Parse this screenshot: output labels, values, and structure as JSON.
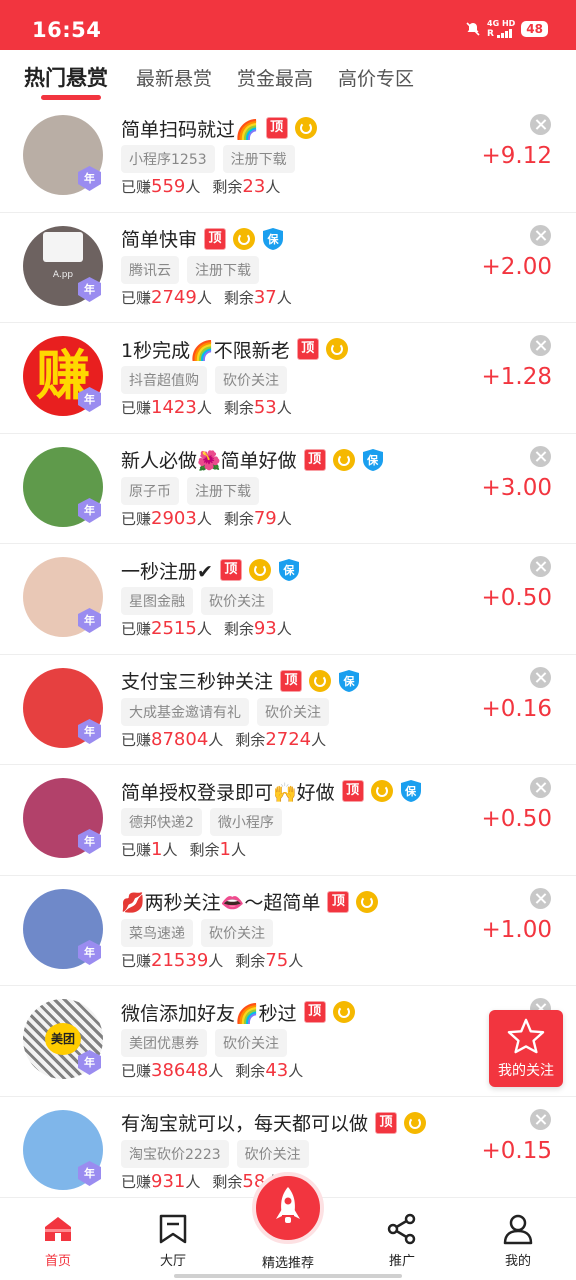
{
  "status_bar": {
    "time": "16:54",
    "network": "4G HD",
    "signal_label": "R",
    "battery": "48"
  },
  "tabs": [
    {
      "label": "热门悬赏",
      "active": true
    },
    {
      "label": "最新悬赏",
      "active": false
    },
    {
      "label": "赏金最高",
      "active": false
    },
    {
      "label": "高价专区",
      "active": false
    }
  ],
  "year_badge": "年",
  "top_badge": "顶",
  "guarantee_badge": "保",
  "earned_prefix": "已赚",
  "remaining_prefix": "剩余",
  "person_unit": "人",
  "tasks": [
    {
      "title": "简单扫码就过🌈",
      "tags": [
        "小程序1253",
        "注册下载"
      ],
      "earned": "559",
      "remaining": "23",
      "reward": "+9.12",
      "top": true,
      "coin": true,
      "guarantee": false,
      "avatar_color": "#b9aea5"
    },
    {
      "title": "简单快审",
      "tags": [
        "腾讯云",
        "注册下载"
      ],
      "earned": "2749",
      "remaining": "37",
      "reward": "+2.00",
      "top": true,
      "coin": true,
      "guarantee": true,
      "avatar_color": "#6d6260",
      "avatar_text": "A.pp"
    },
    {
      "title": "1秒完成🌈不限新老",
      "tags": [
        "抖音超值购",
        "砍价关注"
      ],
      "earned": "1423",
      "remaining": "53",
      "reward": "+1.28",
      "top": true,
      "coin": true,
      "guarantee": false,
      "avatar_color": "#e81f1f",
      "avatar_text": "赚"
    },
    {
      "title": "新人必做🌺简单好做",
      "tags": [
        "原子币",
        "注册下载"
      ],
      "earned": "2903",
      "remaining": "79",
      "reward": "+3.00",
      "top": true,
      "coin": true,
      "guarantee": true,
      "avatar_color": "#5f9a4b"
    },
    {
      "title": "一秒注册✔",
      "tags": [
        "星图金融",
        "砍价关注"
      ],
      "earned": "2515",
      "remaining": "93",
      "reward": "+0.50",
      "top": true,
      "coin": true,
      "guarantee": true,
      "avatar_color": "#e9c8b6"
    },
    {
      "title": "支付宝三秒钟关注",
      "tags": [
        "大成基金邀请有礼",
        "砍价关注"
      ],
      "earned": "87804",
      "remaining": "2724",
      "reward": "+0.16",
      "top": true,
      "coin": true,
      "guarantee": true,
      "avatar_color": "#e64040"
    },
    {
      "title": "简单授权登录即可🙌好做",
      "tags": [
        "德邦快递2",
        "微小程序"
      ],
      "earned": "1",
      "remaining": "1",
      "reward": "+0.50",
      "top": true,
      "coin": true,
      "guarantee": true,
      "avatar_color": "#b2416a"
    },
    {
      "title": "💋两秒关注👄～超简单",
      "tags": [
        "菜鸟速递",
        "砍价关注"
      ],
      "earned": "21539",
      "remaining": "75",
      "reward": "+1.00",
      "top": true,
      "coin": true,
      "guarantee": false,
      "avatar_color": "#6f89c9"
    },
    {
      "title": "微信添加好友🌈秒过",
      "tags": [
        "美团优惠券",
        "砍价关注"
      ],
      "earned": "38648",
      "remaining": "43",
      "reward": "",
      "top": true,
      "coin": true,
      "guarantee": false,
      "avatar_color": "#f3f3f3",
      "avatar_text": "美团"
    },
    {
      "title": "有淘宝就可以，每天都可以做",
      "tags": [
        "淘宝砍价2223",
        "砍价关注"
      ],
      "earned": "931",
      "remaining": "58",
      "reward": "+0.15",
      "top": true,
      "coin": true,
      "guarantee": false,
      "avatar_color": "#7fb6ea"
    }
  ],
  "floating": {
    "label": "我的关注"
  },
  "tab_bar": [
    {
      "label": "首页",
      "icon": "home-icon",
      "active": true
    },
    {
      "label": "大厅",
      "icon": "hall-icon",
      "active": false
    },
    {
      "label": "精选推荐",
      "icon": "rocket-icon",
      "active": false
    },
    {
      "label": "推广",
      "icon": "share-icon",
      "active": false
    },
    {
      "label": "我的",
      "icon": "user-icon",
      "active": false
    }
  ],
  "colors": {
    "brand": "#f2353f",
    "coin": "#f5b800",
    "guarantee": "#1a9fef",
    "year": "#9a8cf0"
  }
}
